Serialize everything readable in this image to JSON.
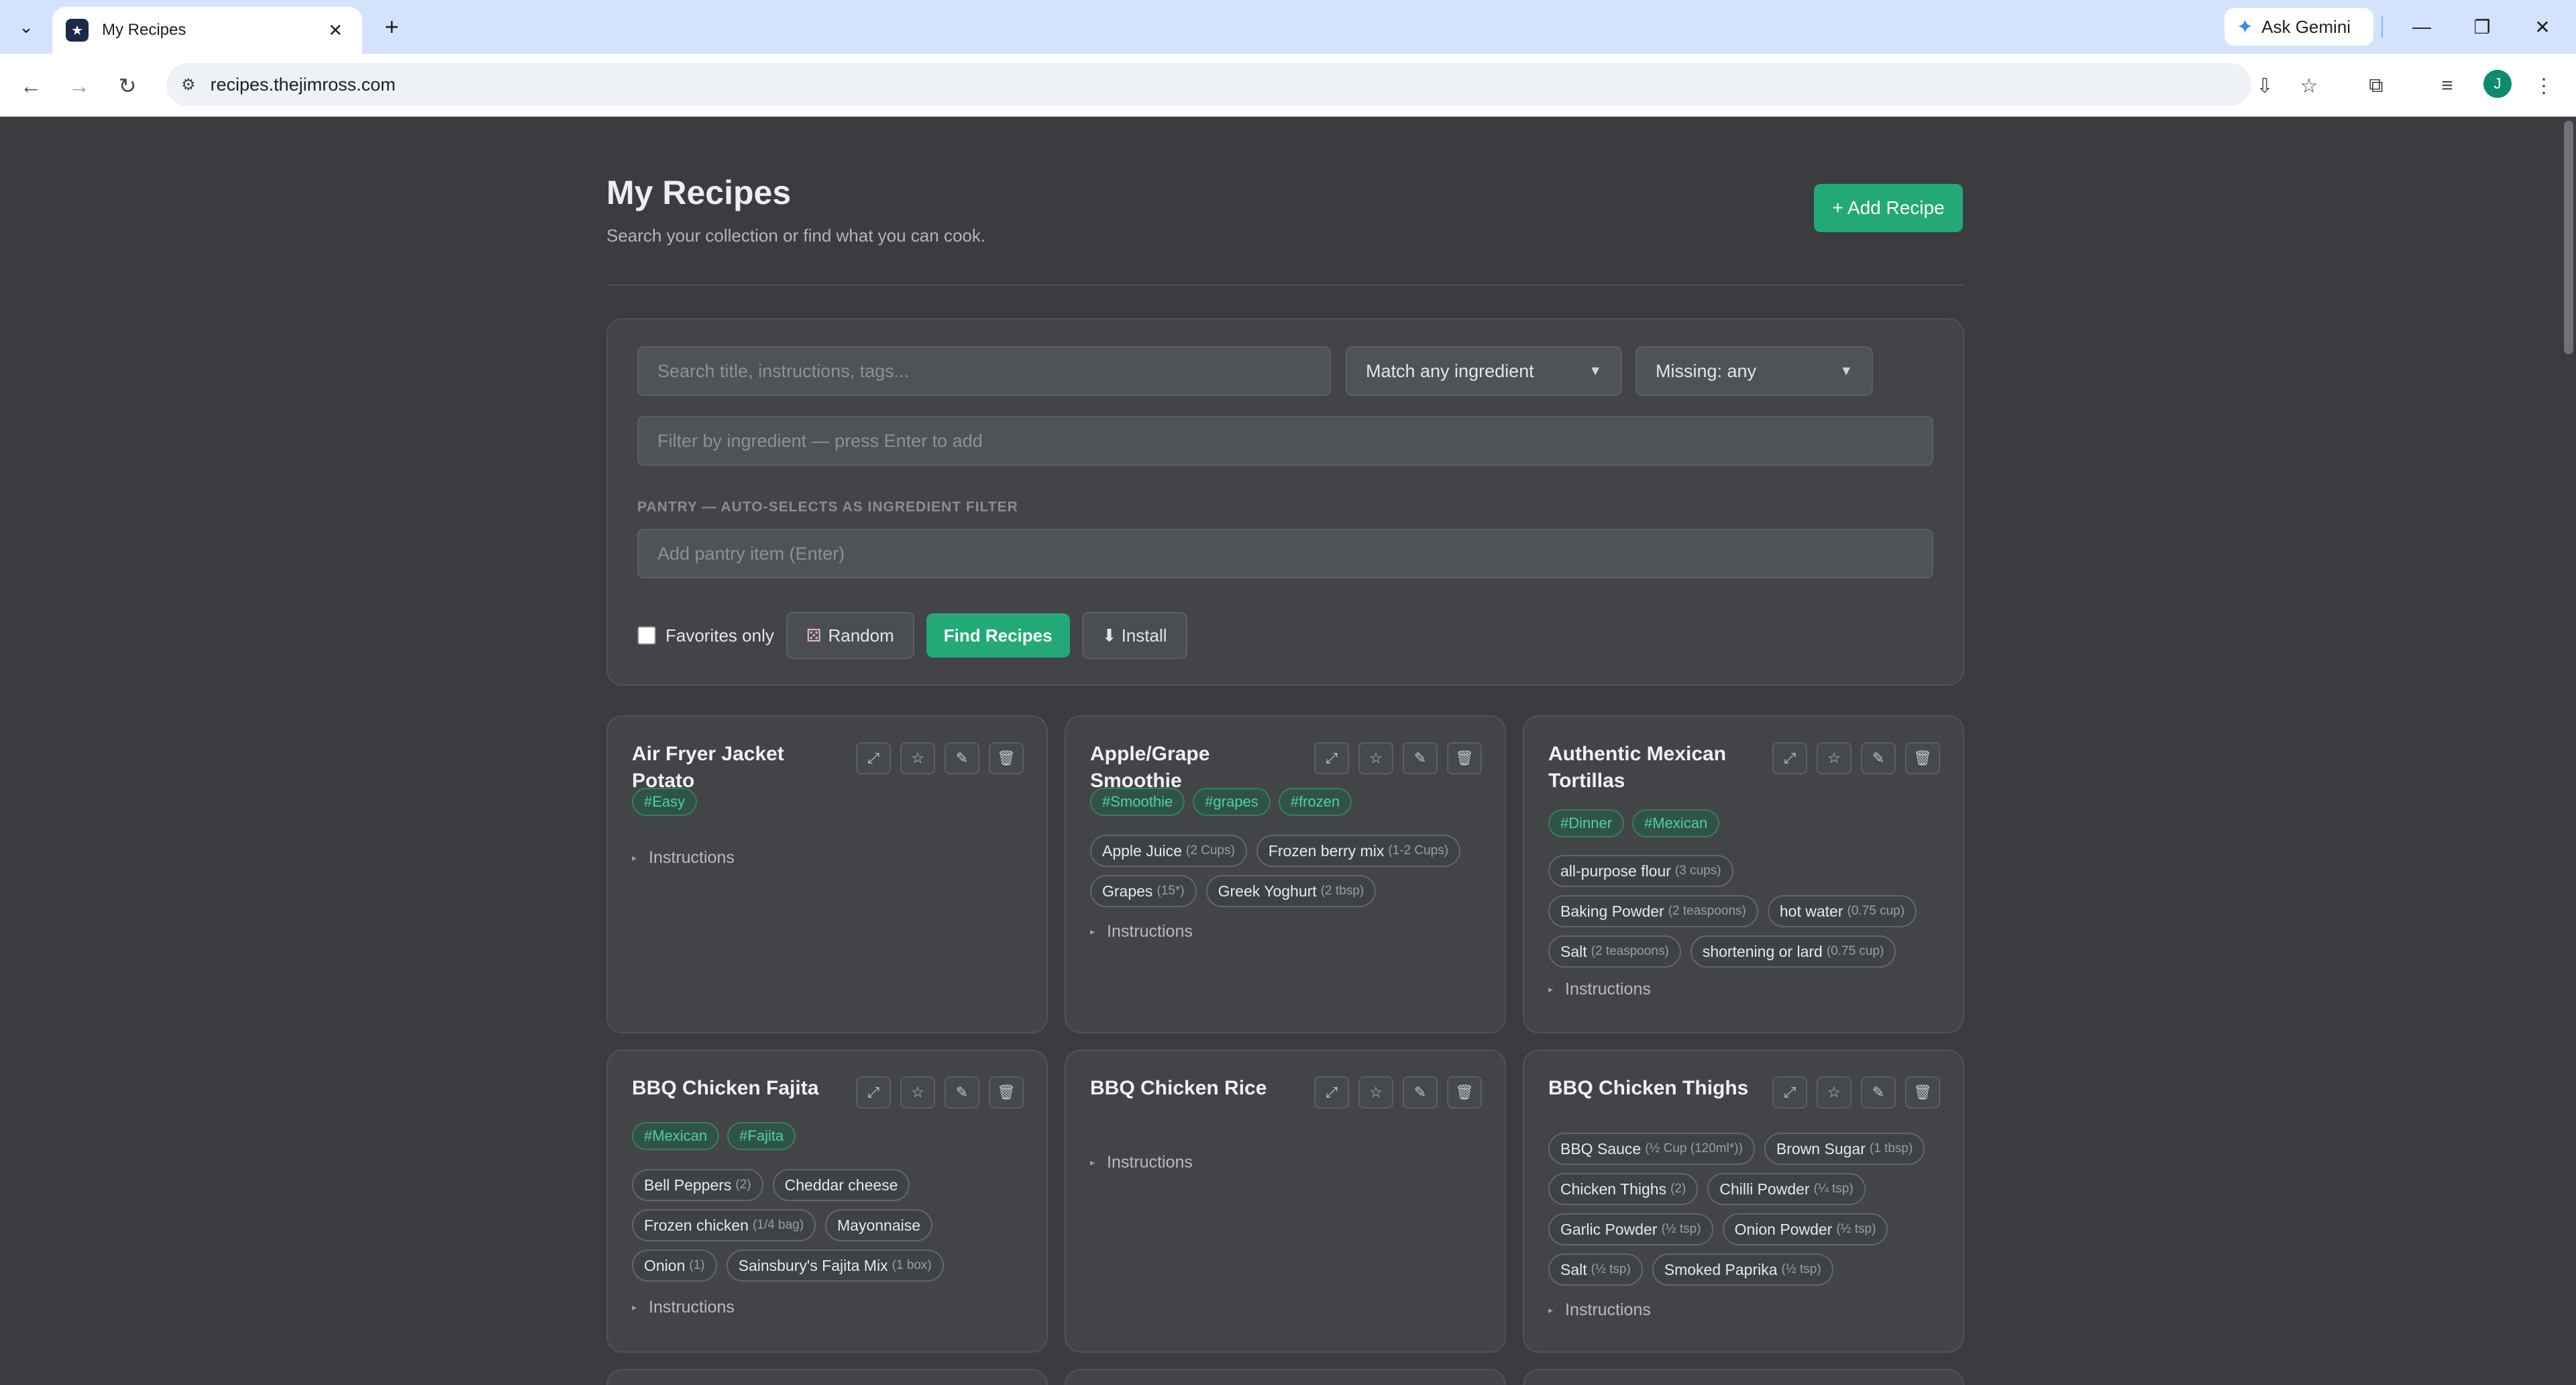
{
  "browser": {
    "tab_title": "My Recipes",
    "url": "recipes.thejimross.com",
    "ask_gemini": "Ask Gemini",
    "profile_initial": "J"
  },
  "header": {
    "title": "My Recipes",
    "subtitle": "Search your collection or find what you can cook.",
    "add_button": "+ Add Recipe"
  },
  "filters": {
    "search_placeholder": "Search title, instructions, tags...",
    "match_select": "Match any ingredient",
    "missing_select": "Missing: any",
    "ingredient_placeholder": "Filter by ingredient — press Enter to add",
    "pantry_label": "PANTRY — AUTO-SELECTS AS INGREDIENT FILTER",
    "pantry_placeholder": "Add pantry item (Enter)",
    "favorites_label": "Favorites only",
    "random_button": "Random",
    "find_button": "Find Recipes",
    "install_button": "⬇ Install"
  },
  "instructions_label": "Instructions",
  "recipes": [
    {
      "title": "Air Fryer Jacket Potato",
      "tags": [
        "#Easy"
      ],
      "ingredients": []
    },
    {
      "title": "Apple/Grape Smoothie",
      "tags": [
        "#Smoothie",
        "#grapes",
        "#frozen"
      ],
      "ingredients": [
        {
          "name": "Apple Juice",
          "qty": "(2 Cups)"
        },
        {
          "name": "Frozen berry mix",
          "qty": "(1-2 Cups)"
        },
        {
          "name": "Grapes",
          "qty": "(15*)"
        },
        {
          "name": "Greek Yoghurt",
          "qty": "(2 tbsp)"
        }
      ]
    },
    {
      "title": "Authentic Mexican Tortillas",
      "tags": [
        "#Dinner",
        "#Mexican"
      ],
      "ingredients": [
        {
          "name": "all-purpose flour",
          "qty": "(3 cups)"
        },
        {
          "name": "Baking Powder",
          "qty": "(2 teaspoons)"
        },
        {
          "name": "hot water",
          "qty": "(0.75 cup)"
        },
        {
          "name": "Salt",
          "qty": "(2 teaspoons)"
        },
        {
          "name": "shortening or lard",
          "qty": "(0.75 cup)"
        }
      ]
    },
    {
      "title": "BBQ Chicken Fajita",
      "tags": [
        "#Mexican",
        "#Fajita"
      ],
      "ingredients": [
        {
          "name": "Bell Peppers",
          "qty": "(2)"
        },
        {
          "name": "Cheddar cheese",
          "qty": ""
        },
        {
          "name": "Frozen chicken",
          "qty": "(1/4 bag)"
        },
        {
          "name": "Mayonnaise",
          "qty": ""
        },
        {
          "name": "Onion",
          "qty": "(1)"
        },
        {
          "name": "Sainsbury's Fajita Mix",
          "qty": "(1 box)"
        }
      ]
    },
    {
      "title": "BBQ Chicken Rice",
      "tags": [],
      "ingredients": []
    },
    {
      "title": "BBQ Chicken Thighs",
      "tags": [],
      "ingredients": [
        {
          "name": "BBQ Sauce",
          "qty": "(½ Cup (120ml*))"
        },
        {
          "name": "Brown Sugar",
          "qty": "(1 tbsp)"
        },
        {
          "name": "Chicken Thighs",
          "qty": "(2)"
        },
        {
          "name": "Chilli Powder",
          "qty": "(¼ tsp)"
        },
        {
          "name": "Garlic Powder",
          "qty": "(½ tsp)"
        },
        {
          "name": "Onion Powder",
          "qty": "(½ tsp)"
        },
        {
          "name": "Salt",
          "qty": "(½ tsp)"
        },
        {
          "name": "Smoked Paprika",
          "qty": "(½ tsp)"
        }
      ]
    }
  ]
}
